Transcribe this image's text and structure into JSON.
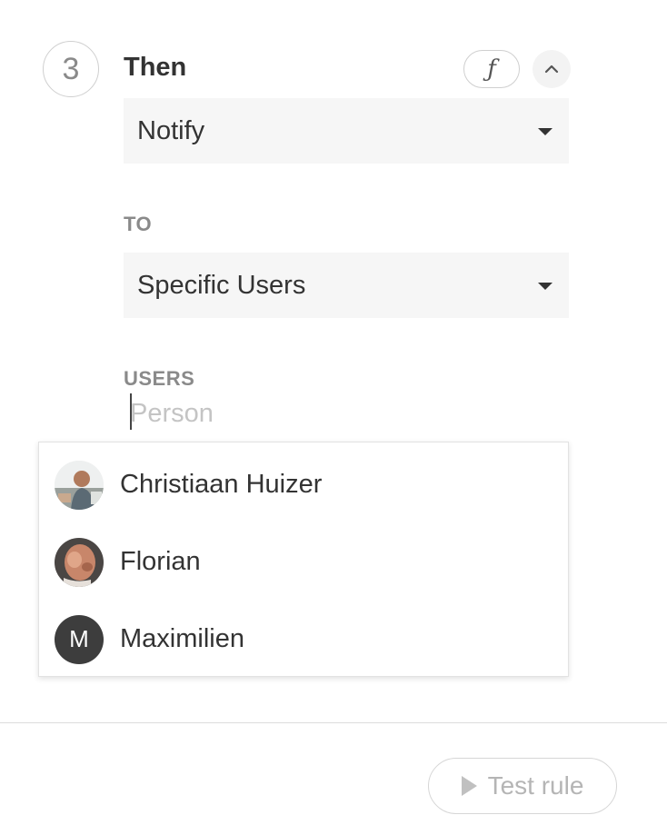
{
  "step": {
    "number": "3",
    "title": "Then",
    "fx_label": "ƒ"
  },
  "action_select": {
    "value": "Notify"
  },
  "to": {
    "label": "TO",
    "value": "Specific Users"
  },
  "users": {
    "label": "USERS",
    "placeholder": "Person",
    "options": [
      {
        "name": "Christiaan Huizer",
        "avatar": "photo"
      },
      {
        "name": "Florian",
        "avatar": "photo"
      },
      {
        "name": "Maximilien",
        "avatar": "initial",
        "initial": "M"
      }
    ]
  },
  "footer": {
    "test_button_label": "Test rule"
  }
}
